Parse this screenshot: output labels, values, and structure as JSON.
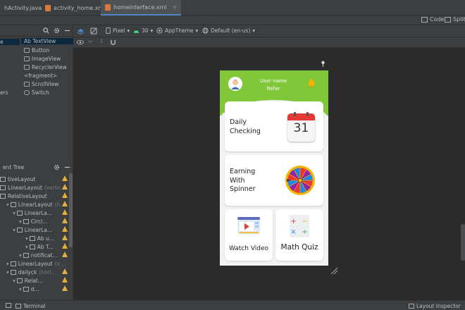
{
  "tabs": [
    {
      "label": "hActivity.java",
      "active": false
    },
    {
      "label": "activity_home.xml",
      "active": false
    },
    {
      "label": "homeinterface.xml",
      "active": true
    }
  ],
  "view_modes": {
    "code": "Code",
    "split": "Split"
  },
  "palette": {
    "categories": [
      {
        "label": "e",
        "selected": true
      },
      {
        "label": "ers",
        "selected": false
      }
    ],
    "items": [
      {
        "label": "Ab TextView",
        "icon": "textview-icon",
        "selected": true
      },
      {
        "label": "Button",
        "icon": "button-icon",
        "selected": false
      },
      {
        "label": "ImageView",
        "icon": "imageview-icon",
        "selected": false
      },
      {
        "label": "RecyclerView",
        "icon": "recyclerview-icon",
        "selected": false
      },
      {
        "label": "<fragment>",
        "icon": "fragment-icon",
        "selected": false
      },
      {
        "label": "ScrollView",
        "icon": "scrollview-icon",
        "selected": false
      },
      {
        "label": "Switch",
        "icon": "switch-icon",
        "selected": false
      }
    ]
  },
  "design_toolbar": {
    "device": "Pixel",
    "api": "30",
    "theme": "AppTheme",
    "locale": "Default (en-us)"
  },
  "component_tree": {
    "title": "ent Tree",
    "rows": [
      {
        "label": "tiveLayout",
        "sub": "",
        "indent": 0,
        "warn": true
      },
      {
        "label": "LinearLayout",
        "sub": "(vertic...",
        "indent": 0,
        "warn": true
      },
      {
        "label": "RelativeLayout",
        "sub": "",
        "indent": 0,
        "warn": true
      },
      {
        "label": "LinearLayout",
        "sub": "(h...",
        "indent": 1,
        "warn": true
      },
      {
        "label": "LinearLa...",
        "sub": "",
        "indent": 2,
        "warn": true
      },
      {
        "label": "Circl...",
        "sub": "",
        "indent": 3,
        "warn": true
      },
      {
        "label": "LinearLa...",
        "sub": "",
        "indent": 2,
        "warn": true
      },
      {
        "label": "Ab u...",
        "sub": "",
        "indent": 4,
        "warn": true
      },
      {
        "label": "Ab T...",
        "sub": "",
        "indent": 4,
        "warn": true
      },
      {
        "label": "notificat...",
        "sub": "",
        "indent": 3,
        "warn": true
      },
      {
        "label": "LinearLayout",
        "sub": "(v...",
        "indent": 1,
        "warn": false
      },
      {
        "label": "dailyck",
        "sub": "(hori...",
        "indent": 1,
        "warn": true
      },
      {
        "label": "Relat...",
        "sub": "",
        "indent": 2,
        "warn": true
      },
      {
        "label": "d...",
        "sub": "",
        "indent": 3,
        "warn": true
      }
    ]
  },
  "phone": {
    "user_name": "User name",
    "user_sub": "Refar",
    "cards": {
      "daily": {
        "title_line1": "Daily",
        "title_line2": "Checking",
        "calendar_number": "31"
      },
      "earning": {
        "title_line1": "Earning",
        "title_line2": "With",
        "title_line3": "Spinner"
      },
      "video": {
        "title": "Watch Video"
      },
      "quiz": {
        "title": "Math Quiz"
      }
    }
  },
  "bottom_bar": {
    "terminal": "Terminal",
    "layout_inspector": "Layout Inspector"
  },
  "colors": {
    "header_green": "#80c73a",
    "ide_bg": "#2b2b2b",
    "panel_bg": "#3c3f41",
    "selection": "#0d293e",
    "warn": "#e0b13c"
  }
}
